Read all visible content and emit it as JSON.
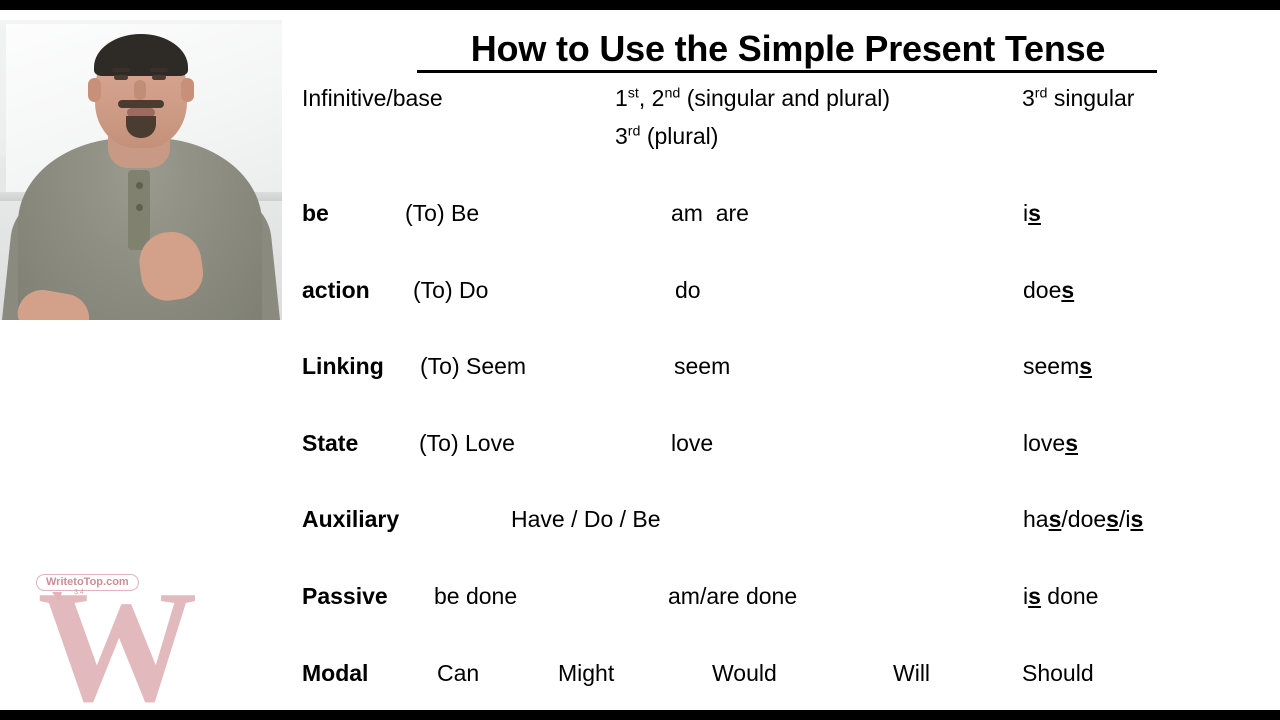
{
  "slide": {
    "title": "How to Use the Simple Present Tense",
    "headers": {
      "col1": "Infinitive/base",
      "col2_line1_pre": "1",
      "col2_line1_sup1": "st",
      "col2_line1_mid": ", 2",
      "col2_line1_sup2": "nd",
      "col2_line1_post": " (singular and plural)",
      "col2_line2_pre": "3",
      "col2_line2_sup": "rd",
      "col2_line2_post": " (plural)",
      "col3_pre": "3",
      "col3_sup": "rd",
      "col3_post": " singular"
    },
    "rows": [
      {
        "label": "be",
        "base": "(To) Be",
        "plural": "am  are",
        "singular_stem": "i",
        "singular_suffix": "s",
        "singular_tail": ""
      },
      {
        "label": "action",
        "base": "(To) Do",
        "plural": "do",
        "singular_stem": "doe",
        "singular_suffix": "s",
        "singular_tail": ""
      },
      {
        "label": "Linking",
        "base": "(To) Seem",
        "plural": "seem",
        "singular_stem": "seem",
        "singular_suffix": "s",
        "singular_tail": ""
      },
      {
        "label": "State",
        "base": "(To) Love",
        "plural": "love",
        "singular_stem": "love",
        "singular_suffix": "s",
        "singular_tail": ""
      },
      {
        "label": "Auxiliary",
        "base": "Have / Do / Be",
        "plural": "",
        "singular_stem": "ha",
        "singular_suffix": "s",
        "singular_tail": "/doe",
        "singular_suffix2": "s",
        "singular_tail2": "/i",
        "singular_suffix3": "s"
      },
      {
        "label": "Passive",
        "base": "be done",
        "plural": "am/are done",
        "singular_stem": "i",
        "singular_suffix": "s",
        "singular_tail": " done"
      }
    ],
    "modal_row": {
      "label": "Modal",
      "options": [
        "Can",
        "Might",
        "Would",
        "Will",
        "Should"
      ]
    }
  },
  "watermark": {
    "letter": "W",
    "bubble_text": "WritetoTop.com",
    "sub_text": "3.4"
  },
  "video": {
    "alt": "instructor-video-inset"
  },
  "colors": {
    "background": "#ffffff",
    "letterbox": "#000000",
    "text": "#000000",
    "watermark": "#e2b9bd"
  }
}
